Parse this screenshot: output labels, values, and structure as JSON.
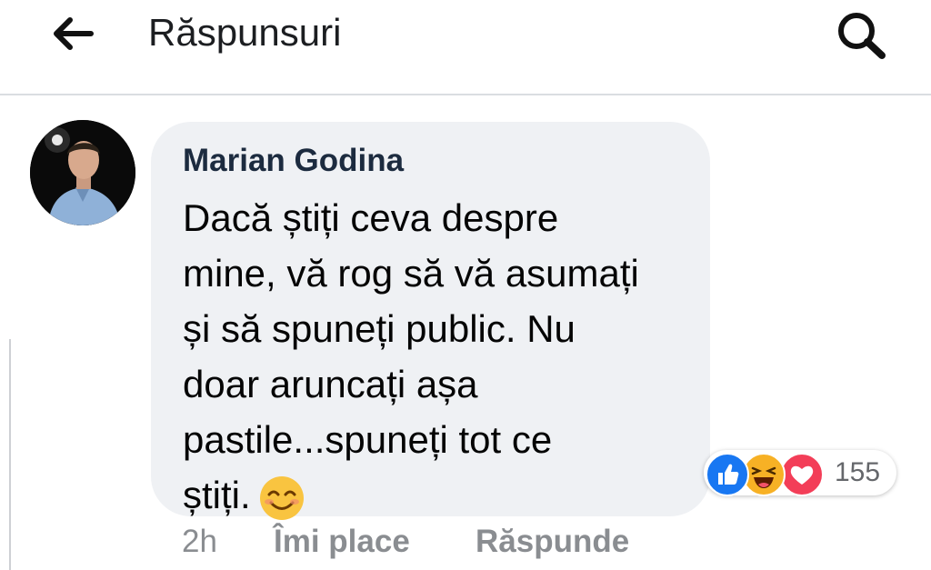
{
  "header": {
    "title": "Răspunsuri",
    "back_icon": "arrow-left-icon",
    "search_icon": "search-icon"
  },
  "comment": {
    "author": "Marian Godina",
    "lines": [
      "Dacă știți ceva despre",
      "mine, vă rog să vă asumați",
      "și să spuneți public. Nu",
      "doar aruncați așa",
      "pastile...spuneți tot ce",
      "știți."
    ],
    "emoji": "smiling-face-icon",
    "time": "2h",
    "like_label": "Îmi place",
    "reply_label": "Răspunde",
    "reactions": {
      "icons": [
        "like-icon",
        "haha-icon",
        "love-icon"
      ],
      "count": "155"
    }
  },
  "colors": {
    "bubble": "#eff1f4",
    "author": "#1c2b3f",
    "like": "#1877f2",
    "haha": "#f7b125",
    "love": "#f33e58",
    "meta": "#8a8d91"
  }
}
